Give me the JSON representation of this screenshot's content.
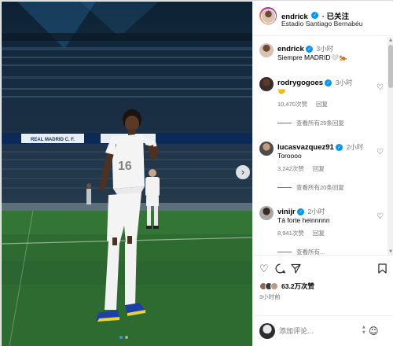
{
  "post": {
    "username": "endrick",
    "follow_label": "· 已关注",
    "location": "Estadio Santiago Bernabéu",
    "caption": {
      "username": "endrick",
      "time": "3小时",
      "text": "Siempre MADRID🤍🐅"
    }
  },
  "photo": {
    "board_text": "REAL MADRID C. F.",
    "jersey_number": "16"
  },
  "comments": [
    {
      "username": "rodrygogoes",
      "time": "3小时",
      "text": "🤝",
      "likes": "10,470次赞",
      "reply_label": "回复",
      "view_replies": "查看所有29条回复"
    },
    {
      "username": "lucasvazquez91",
      "time": "2小时",
      "text": "Toroooo",
      "likes": "3,242次赞",
      "reply_label": "回复",
      "view_replies": "查看所有20条回复"
    },
    {
      "username": "vinijr",
      "time": "2小时",
      "text": "Tá forte heinnnnn",
      "likes": "8,941次赞",
      "reply_label": "回复",
      "view_replies": "查看所有..."
    }
  ],
  "actions": {
    "likes_count": "63.2万次赞",
    "posted_time": "3小时前",
    "add_comment_placeholder": "添加评论..."
  },
  "icons": {
    "like": "heart-icon",
    "comment": "comment-icon",
    "share": "share-icon",
    "save": "bookmark-icon",
    "emoji": "emoji-icon",
    "next": "chevron-right-icon"
  },
  "colors": {
    "verified": "#0095f6",
    "muted": "#737373",
    "pitch": "#2b6a30",
    "dot_active": "#3897f0"
  }
}
